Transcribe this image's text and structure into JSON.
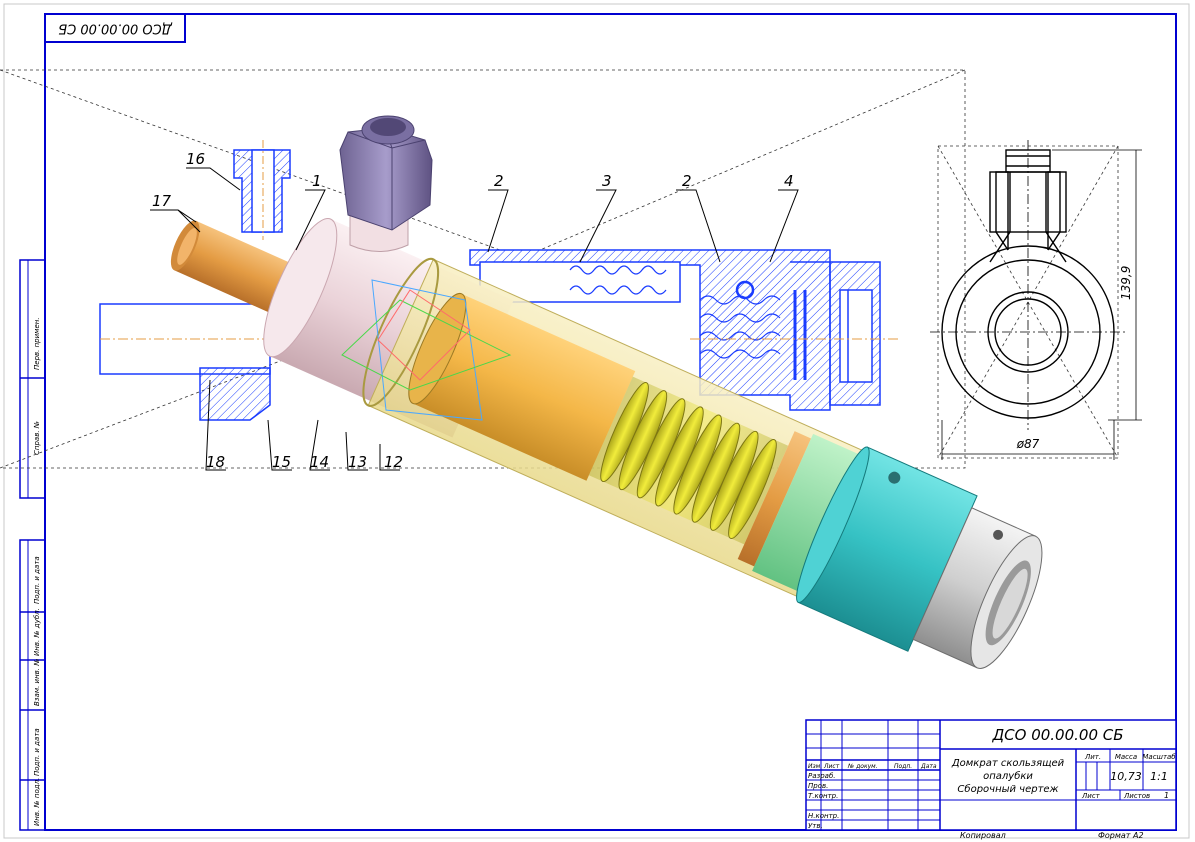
{
  "sheet": {
    "top_stamp": "ДСО 00.00.00 СБ",
    "designation": "ДСО 00.00.00 СБ",
    "title_line1": "Домкрат скользящей",
    "title_line2": "опалубки",
    "title_line3": "Сборочный чертеж",
    "col_lit": "Лит.",
    "col_mass": "Масса",
    "col_scale": "Масштаб",
    "mass_value": "10,73",
    "scale_value": "1:1",
    "sheet_label": "Лист",
    "sheets_label": "Листов",
    "sheets_value": "1",
    "copied": "Копировал",
    "format": "Формат   A2",
    "row_izm": "Изм. Лист",
    "row_doc": "№ докум.",
    "row_sign": "Подп.",
    "row_date": "Дата",
    "row_razrab": "Разраб.",
    "row_prov": "Пров.",
    "row_tkontr": "Т.контр.",
    "row_nkontr": "Н.контр.",
    "row_utv": "Утв.",
    "side_perv": "Перв. примен.",
    "side_sprav": "Справ. №",
    "side_podp_data1": "Подп. и дата",
    "side_inv_dubl": "Инв. № дубл.",
    "side_vzam": "Взам. инв. №",
    "side_podp_data2": "Подп. и дата",
    "side_inv_podl": "Инв. № подл."
  },
  "callouts": [
    "16",
    "17",
    "1",
    "2",
    "3",
    "2",
    "4",
    "18",
    "15",
    "14",
    "13",
    "12"
  ],
  "dimensions": {
    "diameter": "ø87",
    "height": "139,9"
  },
  "colors": {
    "frame": "#0000d0",
    "section": "#1a3cff",
    "copper": "#e8a452",
    "pink_body": "#f3e0e4",
    "nut": "#8a7fae",
    "glass": "#f3e7a6",
    "spring": "#d7d12a",
    "cyan": "#3cc6c8",
    "steel": "#c8c8c8"
  }
}
